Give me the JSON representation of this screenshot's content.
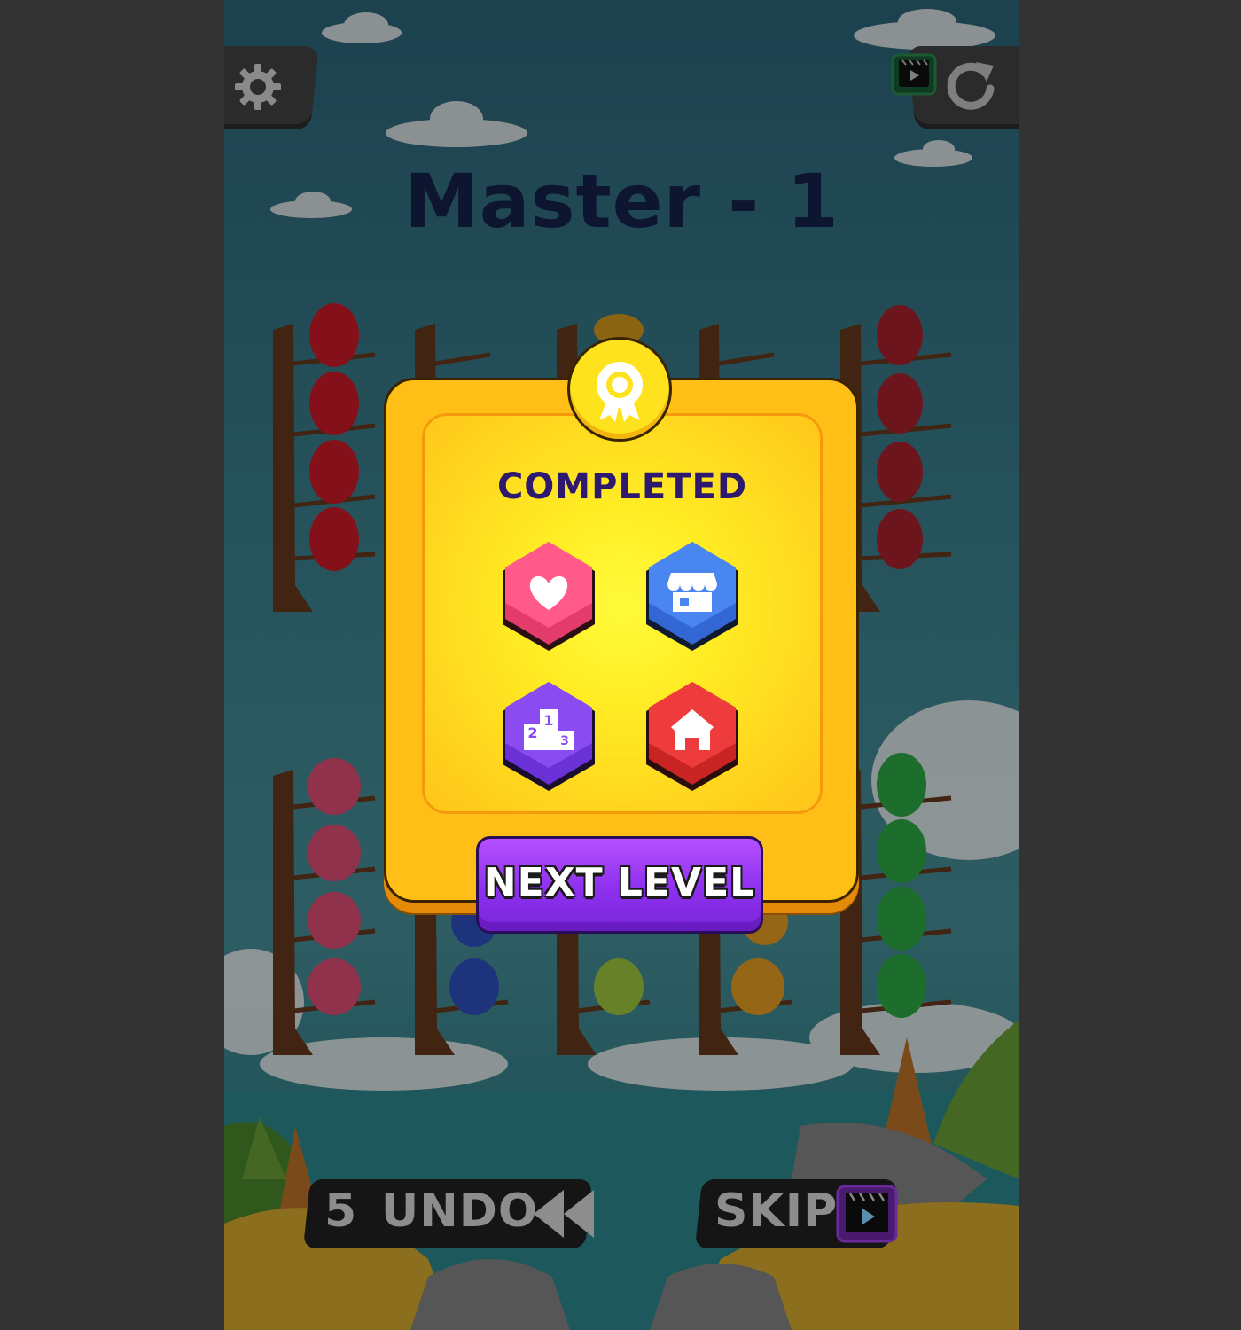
{
  "level": {
    "title": "Master - 1"
  },
  "top_bar": {
    "settings_icon": "gear-icon",
    "video_icon": "clapperboard-play-icon",
    "restart_icon": "restart-icon"
  },
  "bottom_bar": {
    "undo_count": "5",
    "undo_label": "UNDO",
    "skip_label": "SKIP"
  },
  "modal": {
    "title": "COMPLETED",
    "badge_icon": "award-ribbon-icon",
    "buttons": [
      {
        "name": "like",
        "icon": "heart-icon",
        "color": "#ff5a8a"
      },
      {
        "name": "shop",
        "icon": "shop-icon",
        "color": "#4a86f0"
      },
      {
        "name": "leaderboard",
        "icon": "podium-icon",
        "color": "#8a4cf0"
      },
      {
        "name": "home",
        "icon": "home-icon",
        "color": "#ee3c3c"
      }
    ],
    "next_label": "NEXT LEVEL"
  },
  "colors": {
    "modal": "#ffbf16",
    "next_button": "#9b3cf7",
    "title": "#0d1530",
    "completed": "#2d1a6e"
  }
}
